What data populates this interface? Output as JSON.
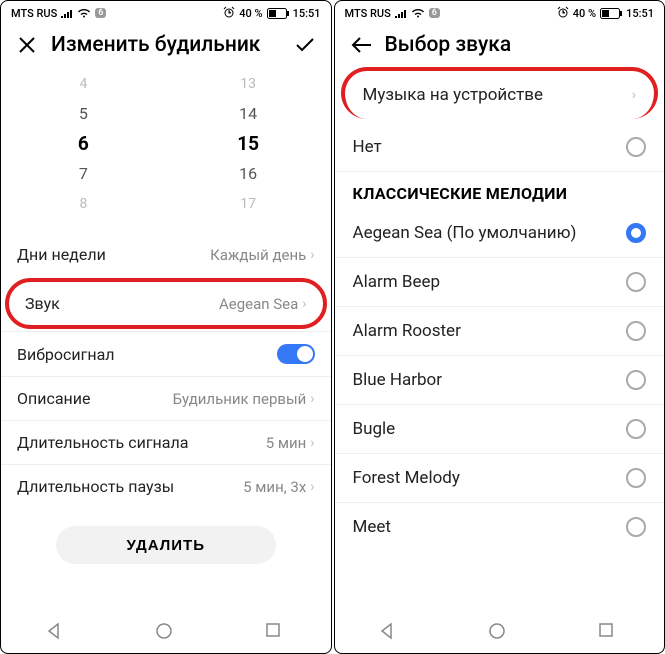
{
  "status": {
    "carrier": "MTS RUS",
    "netbadge": "6",
    "battery_pct": "40 %",
    "time": "15:51"
  },
  "screen1": {
    "title": "Изменить будильник",
    "picker": {
      "h": [
        "4",
        "5",
        "6",
        "7",
        "8"
      ],
      "m": [
        "13",
        "14",
        "15",
        "16",
        "17"
      ]
    },
    "rows": {
      "days_label": "Дни недели",
      "days_val": "Каждый день",
      "sound_label": "Звук",
      "sound_val": "Aegean Sea",
      "vibro_label": "Вибросигнал",
      "desc_label": "Описание",
      "desc_val": "Будильник первый",
      "siglen_label": "Длительность сигнала",
      "siglen_val": "5 мин",
      "pauselen_label": "Длительность паузы",
      "pauselen_val": "5 мин, 3x"
    },
    "delete": "УДАЛИТЬ"
  },
  "screen2": {
    "title": "Выбор звука",
    "device_music": "Музыка на устройстве",
    "none": "Нет",
    "section": "КЛАССИЧЕСКИЕ МЕЛОДИИ",
    "items": [
      "Aegean Sea (По умолчанию)",
      "Alarm Beep",
      "Alarm Rooster",
      "Blue Harbor",
      "Bugle",
      "Forest Melody",
      "Meet"
    ]
  }
}
